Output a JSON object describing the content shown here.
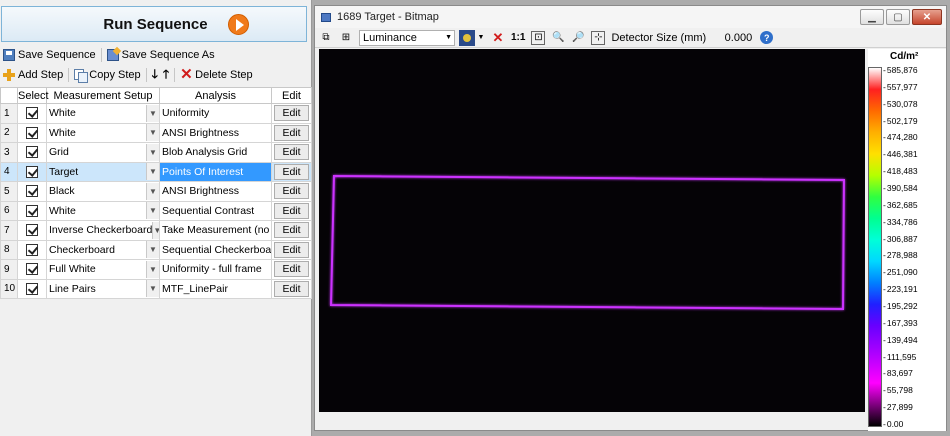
{
  "left_panel": {
    "run_button_label": "Run Sequence",
    "toolbar1": {
      "save_sequence": "Save Sequence",
      "save_sequence_as": "Save Sequence As"
    },
    "toolbar2": {
      "add_step": "Add Step",
      "copy_step": "Copy Step",
      "delete_step": "Delete Step"
    },
    "grid": {
      "headers": {
        "select": "Select",
        "measurement_setup": "Measurement Setup",
        "analysis": "Analysis",
        "edit": "Edit"
      },
      "rows": [
        {
          "num": "1",
          "setup": "White",
          "analysis": "Uniformity",
          "edit": "Edit",
          "checked": true
        },
        {
          "num": "2",
          "setup": "White",
          "analysis": "ANSI Brightness",
          "edit": "Edit",
          "checked": true
        },
        {
          "num": "3",
          "setup": "Grid",
          "analysis": "Blob Analysis Grid",
          "edit": "Edit",
          "checked": true
        },
        {
          "num": "4",
          "setup": "Target",
          "analysis": "Points Of Interest",
          "edit": "Edit",
          "checked": true,
          "selected": true
        },
        {
          "num": "5",
          "setup": "Black",
          "analysis": "ANSI Brightness",
          "edit": "Edit",
          "checked": true
        },
        {
          "num": "6",
          "setup": "White",
          "analysis": "Sequential Contrast",
          "edit": "Edit",
          "checked": true
        },
        {
          "num": "7",
          "setup": "Inverse Checkerboard",
          "analysis": "Take Measurement (no A...",
          "edit": "Edit",
          "checked": true
        },
        {
          "num": "8",
          "setup": "Checkerboard",
          "analysis": "Sequential Checkerboard ...",
          "edit": "Edit",
          "checked": true
        },
        {
          "num": "9",
          "setup": "Full White",
          "analysis": "Uniformity - full frame",
          "edit": "Edit",
          "checked": true
        },
        {
          "num": "10",
          "setup": "Line Pairs",
          "analysis": "MTF_LinePair",
          "edit": "Edit",
          "checked": true
        }
      ]
    }
  },
  "bitmap_window": {
    "title": "1689 Target - Bitmap",
    "toolbar": {
      "display_mode": "Luminance",
      "one_to_one": "1:1",
      "detector_size_label": "Detector Size (mm)",
      "detector_size_value": "0.000"
    },
    "scale": {
      "unit": "Cd/m²",
      "ticks": [
        "585,876",
        "557,977",
        "530,078",
        "502,179",
        "474,280",
        "446,381",
        "418,483",
        "390,584",
        "362,685",
        "334,786",
        "306,887",
        "278,988",
        "251,090",
        "223,191",
        "195,292",
        "167,393",
        "139,494",
        "111,595",
        "83,697",
        "55,798",
        "27,899",
        "0.00"
      ]
    },
    "colors": {
      "target_outline": "#cc33ff",
      "background": "#050306",
      "accent": "#3399ff"
    }
  }
}
